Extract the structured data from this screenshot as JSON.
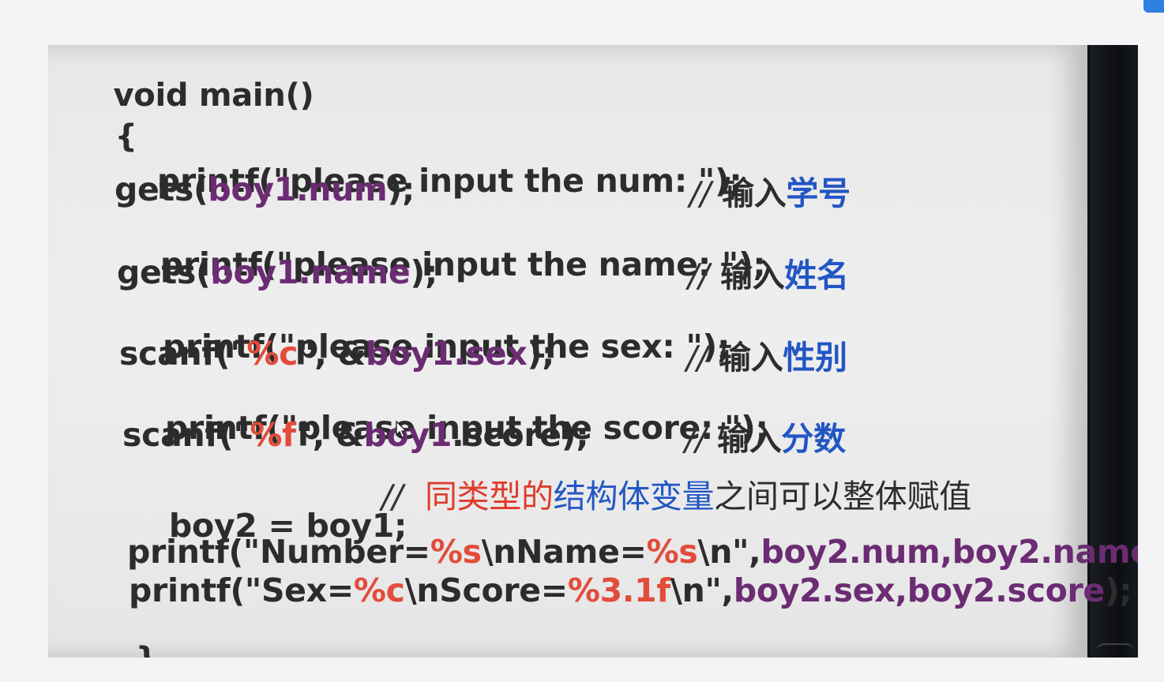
{
  "code": {
    "sig": "void main()",
    "open": "{",
    "close": "}",
    "l1": "printf(\"please input the num: \");",
    "l2a": "gets(",
    "l2b": "boy1.num",
    "l2c": ");",
    "l3": "printf(\"please input the name: \");",
    "l4a": "gets(",
    "l4b": "boy1.name",
    "l4c": ");",
    "l5": "printf(\"please input the sex: \");",
    "l6a": "scanf(\"",
    "l6b": "%c",
    "l6c": "\", &",
    "l6d": "boy1.sex",
    "l6e": ");",
    "l7": "printf(\"please input the score: \");",
    "l8a": "scanf(\"",
    "l8b": "%f",
    "l8c": "\", &",
    "l8d": "boy1",
    "l8e": ".score);",
    "l9": "boy2 = boy1;",
    "l10a": "printf(\"Number=",
    "l10b": "%s",
    "l10c": "\\nName=",
    "l10d": "%s",
    "l10e": "\\n\",",
    "l10f": "boy2.num,boy2.name",
    "l10g": ");",
    "l11a": "printf(\"Sex=",
    "l11b": "%c",
    "l11c": "\\nScore=",
    "l11d": "%3.1f",
    "l11e": "\\n\",",
    "l11f": "boy2.sex,boy2.score",
    "l11g": ");"
  },
  "comments": {
    "slash": "//",
    "c1a": "输入",
    "c1b": "学号",
    "c2a": "输入",
    "c2b": "姓名",
    "c3a": "输入",
    "c3b": "性别",
    "c4a": "输入",
    "c4b": "分数",
    "c5a": "同类型的",
    "c5b": "结构体变量",
    "c5c": "之间可以整体赋值"
  },
  "colors": {
    "keyword_red": "#e34c3a",
    "member_purple": "#6b2c73",
    "comment_blue": "#2256c4"
  }
}
